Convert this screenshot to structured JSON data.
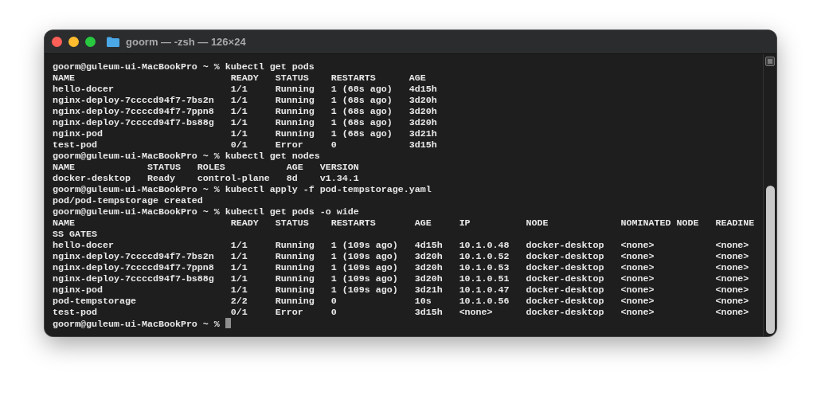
{
  "window": {
    "title": "goorm — -zsh — 126×24"
  },
  "blocks": [
    {
      "kind": "prompt",
      "text": "goorm@guleum-ui-MacBookPro ~ % kubectl get pods"
    },
    {
      "kind": "table",
      "columns": [
        "NAME",
        "READY",
        "STATUS",
        "RESTARTS",
        "AGE"
      ],
      "rows": [
        [
          "hello-docer",
          "1/1",
          "Running",
          "1 (68s ago)",
          "4d15h"
        ],
        [
          "nginx-deploy-7ccccd94f7-7bs2n",
          "1/1",
          "Running",
          "1 (68s ago)",
          "3d20h"
        ],
        [
          "nginx-deploy-7ccccd94f7-7ppn8",
          "1/1",
          "Running",
          "1 (68s ago)",
          "3d20h"
        ],
        [
          "nginx-deploy-7ccccd94f7-bs88g",
          "1/1",
          "Running",
          "1 (68s ago)",
          "3d20h"
        ],
        [
          "nginx-pod",
          "1/1",
          "Running",
          "1 (68s ago)",
          "3d21h"
        ],
        [
          "test-pod",
          "0/1",
          "Error",
          "0",
          "3d15h"
        ]
      ]
    },
    {
      "kind": "prompt",
      "text": "goorm@guleum-ui-MacBookPro ~ % kubectl get nodes"
    },
    {
      "kind": "table",
      "columns": [
        "NAME",
        "STATUS",
        "ROLES",
        "AGE",
        "VERSION"
      ],
      "rows": [
        [
          "docker-desktop",
          "Ready",
          "control-plane",
          "8d",
          "v1.34.1"
        ]
      ]
    },
    {
      "kind": "prompt",
      "text": "goorm@guleum-ui-MacBookPro ~ % kubectl apply -f pod-tempstorage.yaml"
    },
    {
      "kind": "output",
      "text": "pod/pod-tempstorage created"
    },
    {
      "kind": "prompt",
      "text": "goorm@guleum-ui-MacBookPro ~ % kubectl get pods -o wide"
    },
    {
      "kind": "table",
      "columns": [
        "NAME",
        "READY",
        "STATUS",
        "RESTARTS",
        "AGE",
        "IP",
        "NODE",
        "NOMINATED NODE",
        "READINESS GATES"
      ],
      "rows": [
        [
          "hello-docer",
          "1/1",
          "Running",
          "1 (109s ago)",
          "4d15h",
          "10.1.0.48",
          "docker-desktop",
          "<none>",
          "<none>"
        ],
        [
          "nginx-deploy-7ccccd94f7-7bs2n",
          "1/1",
          "Running",
          "1 (109s ago)",
          "3d20h",
          "10.1.0.52",
          "docker-desktop",
          "<none>",
          "<none>"
        ],
        [
          "nginx-deploy-7ccccd94f7-7ppn8",
          "1/1",
          "Running",
          "1 (109s ago)",
          "3d20h",
          "10.1.0.53",
          "docker-desktop",
          "<none>",
          "<none>"
        ],
        [
          "nginx-deploy-7ccccd94f7-bs88g",
          "1/1",
          "Running",
          "1 (109s ago)",
          "3d20h",
          "10.1.0.51",
          "docker-desktop",
          "<none>",
          "<none>"
        ],
        [
          "nginx-pod",
          "1/1",
          "Running",
          "1 (109s ago)",
          "3d21h",
          "10.1.0.47",
          "docker-desktop",
          "<none>",
          "<none>"
        ],
        [
          "pod-tempstorage",
          "2/2",
          "Running",
          "0",
          "10s",
          "10.1.0.56",
          "docker-desktop",
          "<none>",
          "<none>"
        ],
        [
          "test-pod",
          "0/1",
          "Error",
          "0",
          "3d15h",
          "<none>",
          "docker-desktop",
          "<none>",
          "<none>"
        ]
      ]
    },
    {
      "kind": "prompt",
      "text": "goorm@guleum-ui-MacBookPro ~ % ",
      "cursor": true
    }
  ]
}
